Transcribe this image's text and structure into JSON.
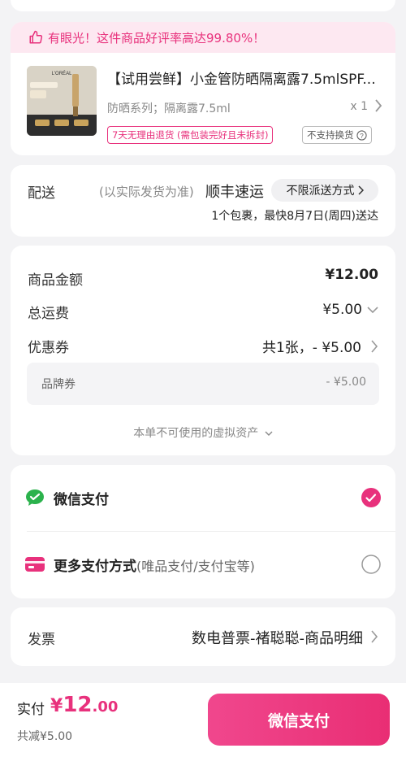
{
  "product": {
    "praise_text": "有眼光！这件商品好评率高达99.80%！",
    "title": "【试用尝鲜】小金管防晒隔离露7.5mlSPF...",
    "spec": "防晒系列；隔离露7.5ml",
    "qty": "x 1",
    "tag_return": "7天无理由退货 (需包装完好且未拆封)",
    "tag_exchange": "不支持换货",
    "image_logo": "L'ORÉAL"
  },
  "delivery": {
    "label": "配送",
    "note": "(以实际发货为准)",
    "carrier": "顺丰速运",
    "method": "不限派送方式",
    "date": "1个包裹，最快8月7日(周四)送达"
  },
  "price": {
    "goods_label": "商品金额",
    "goods_value": "¥12.00",
    "shipping_label": "总运费",
    "shipping_value": "¥5.00",
    "coupon_label": "优惠券",
    "coupon_value": "共1张，- ¥5.00",
    "brand_coupon_label": "品牌券",
    "brand_coupon_value": "- ¥5.00",
    "virtual_note": "本单不可使用的虚拟资产"
  },
  "payment": {
    "wechat_label": "微信支付",
    "more_label": "更多支付方式",
    "more_sub": "(唯品支付/支付宝等)"
  },
  "invoice": {
    "label": "发票",
    "value": "数电普票-褚聪聪-商品明细"
  },
  "footer": {
    "paid_label": "实付",
    "currency": "¥",
    "amount_int": "12",
    "amount_dec": ".00",
    "saved": "共减¥5.00",
    "pay_button": "微信支付"
  },
  "colors": {
    "accent": "#e8317c",
    "wechat": "#2bb24c"
  }
}
